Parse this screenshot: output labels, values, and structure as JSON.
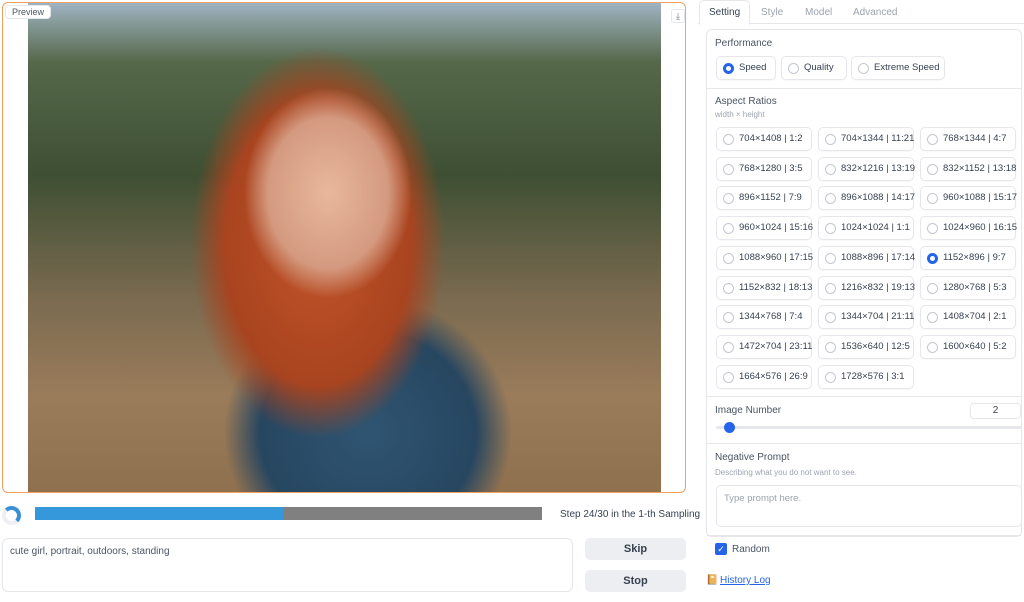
{
  "preview": {
    "label": "Preview",
    "download_icon": "download-icon"
  },
  "progress": {
    "percent": 49,
    "status": "Step 24/30 in the 1-th Sampling",
    "bar_color": "#3498db"
  },
  "prompt": {
    "value": "cute girl, portrait, outdoors, standing"
  },
  "buttons": {
    "skip": "Skip",
    "stop": "Stop"
  },
  "tabs": [
    "Setting",
    "Style",
    "Model",
    "Advanced"
  ],
  "performance": {
    "label": "Performance",
    "options": [
      "Speed",
      "Quality",
      "Extreme Speed"
    ],
    "selected": "Speed"
  },
  "aspect": {
    "label": "Aspect Ratios",
    "sub": "width × height",
    "selected": "1152×896 | 9:7",
    "options": [
      "704×1408 | 1:2",
      "704×1344 | 11:21",
      "768×1344 | 4:7",
      "768×1280 | 3:5",
      "832×1216 | 13:19",
      "832×1152 | 13:18",
      "896×1152 | 7:9",
      "896×1088 | 14:17",
      "960×1088 | 15:17",
      "960×1024 | 15:16",
      "1024×1024 | 1:1",
      "1024×960 | 16:15",
      "1088×960 | 17:15",
      "1088×896 | 17:14",
      "1152×896 | 9:7",
      "1152×832 | 18:13",
      "1216×832 | 19:13",
      "1280×768 | 5:3",
      "1344×768 | 7:4",
      "1344×704 | 21:11",
      "1408×704 | 2:1",
      "1472×704 | 23:11",
      "1536×640 | 12:5",
      "1600×640 | 5:2",
      "1664×576 | 26:9",
      "1728×576 | 3:1"
    ]
  },
  "image_number": {
    "label": "Image Number",
    "value": "2"
  },
  "negative": {
    "label": "Negative Prompt",
    "sub": "Describing what you do not want to see.",
    "placeholder": "Type prompt here."
  },
  "random": {
    "label": "Random",
    "checked": true
  },
  "history": {
    "label": "History Log"
  },
  "accent": "#2563eb"
}
